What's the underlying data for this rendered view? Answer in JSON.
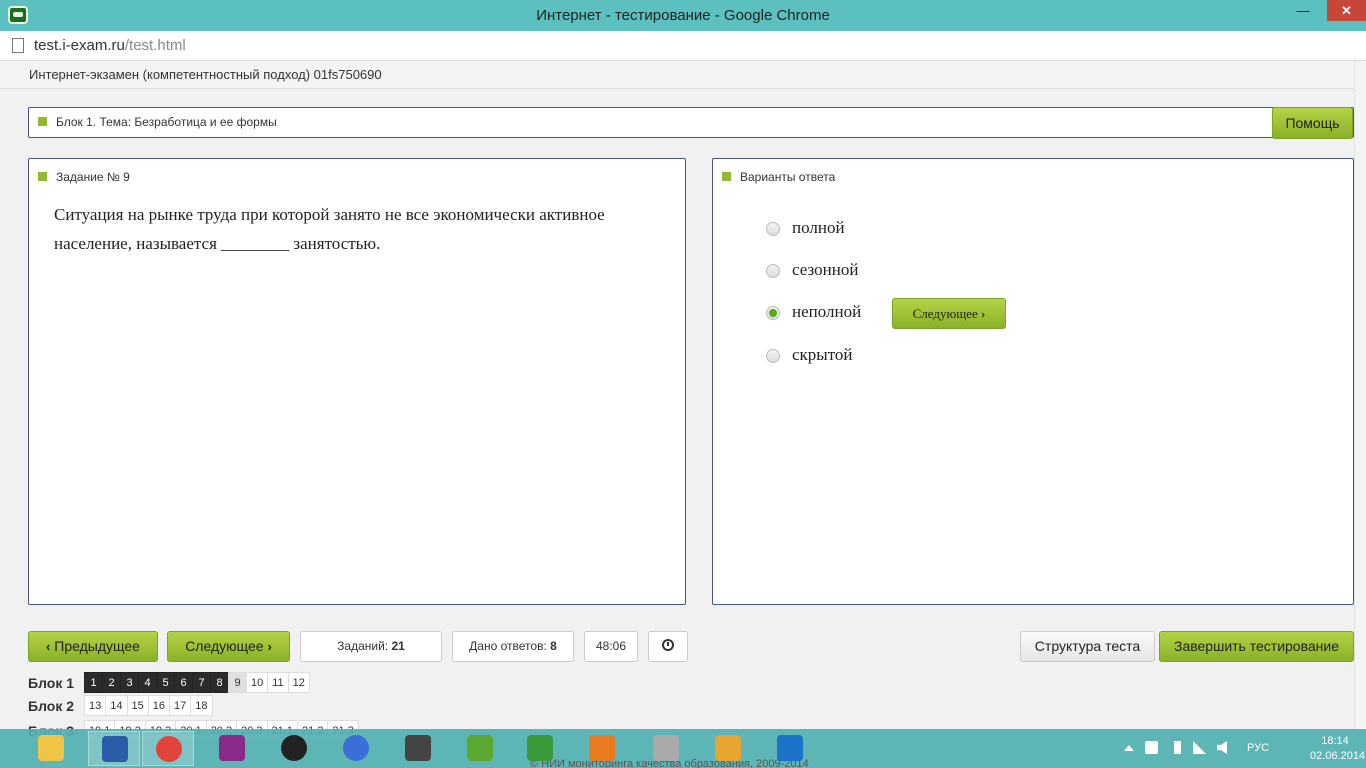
{
  "window": {
    "title": "Интернет - тестирование - Google Chrome",
    "min_icon": "minimize-icon",
    "max_icon": "maximize-icon",
    "close_icon": "close-icon"
  },
  "address": {
    "domain": "test.i-exam.ru",
    "path": "/test.html"
  },
  "header": {
    "exam_title": "Интернет-экзамен (компетентностный подход) 01fs750690"
  },
  "block": {
    "label": "Блок 1. Тема: Безработица и ее формы",
    "help_button": "Помощь"
  },
  "task": {
    "label": "Задание № 9",
    "text": "Ситуация на рынке труда при которой занято не все экономически активное население, называется ________ занятостью."
  },
  "answers": {
    "label": "Варианты ответа",
    "options": [
      {
        "label": "полной",
        "selected": false
      },
      {
        "label": "сезонной",
        "selected": false
      },
      {
        "label": "неполной",
        "selected": true
      },
      {
        "label": "скрытой",
        "selected": false
      }
    ],
    "next_inline": "Следующее"
  },
  "controls": {
    "prev": "Предыдущее",
    "next": "Следующее",
    "tasks_label": "Заданий:",
    "tasks_count": "21",
    "answers_label": "Дано ответов:",
    "answers_count": "8",
    "timer": "48:06",
    "structure": "Структура теста",
    "finish": "Завершить тестирование"
  },
  "blocks_nav": [
    {
      "name": "Блок 1",
      "items": [
        "1",
        "2",
        "3",
        "4",
        "5",
        "6",
        "7",
        "8",
        "9",
        "10",
        "11",
        "12"
      ],
      "answered": 8,
      "current": "9"
    },
    {
      "name": "Блок 2",
      "items": [
        "13",
        "14",
        "15",
        "16",
        "17",
        "18"
      ],
      "answered": 0,
      "current": ""
    },
    {
      "name": "Блок 3",
      "items": [
        "19.1",
        "19.2",
        "19.3",
        "20.1",
        "20.2",
        "20.3",
        "21.1",
        "21.2",
        "21.3"
      ],
      "answered": 0,
      "current": ""
    }
  ],
  "footer": "© НИИ мониторинга качества образования, 2009-2014",
  "taskbar": {
    "apps": [
      "file-explorer-icon",
      "word-icon",
      "chrome-icon",
      "app-c-icon",
      "media-ball-icon",
      "itunes-icon",
      "video-icon",
      "utorrent-icon",
      "search-app-icon",
      "player-icon",
      "disk-icon",
      "paint-icon",
      "browser-k-icon"
    ],
    "language": "РУС",
    "time": "18:14",
    "date": "02.06.2014"
  }
}
